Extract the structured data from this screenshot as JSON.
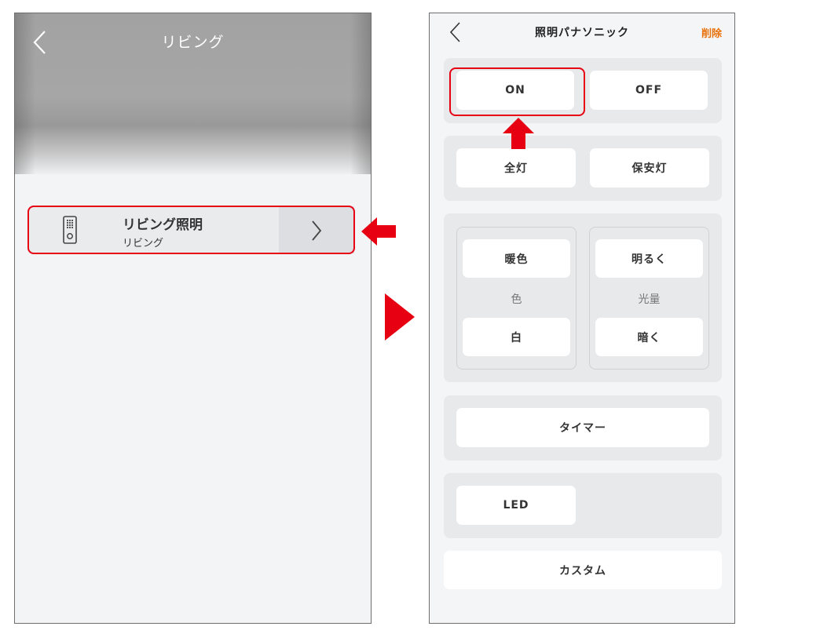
{
  "left_screen": {
    "title": "リビング",
    "device": {
      "name": "リビング照明",
      "room": "リビング"
    }
  },
  "right_screen": {
    "title": "照明パナソニック",
    "delete_label": "削除",
    "buttons": {
      "on": "ON",
      "off": "OFF",
      "full_light": "全灯",
      "night_light": "保安灯",
      "warm": "暖色",
      "color_label": "色",
      "white": "白",
      "brighter": "明るく",
      "brightness_label": "光量",
      "darker": "暗く",
      "timer": "タイマー",
      "led": "LED",
      "custom": "カスタム"
    }
  },
  "colors": {
    "highlight": "#e60012",
    "delete": "#e8710a"
  }
}
